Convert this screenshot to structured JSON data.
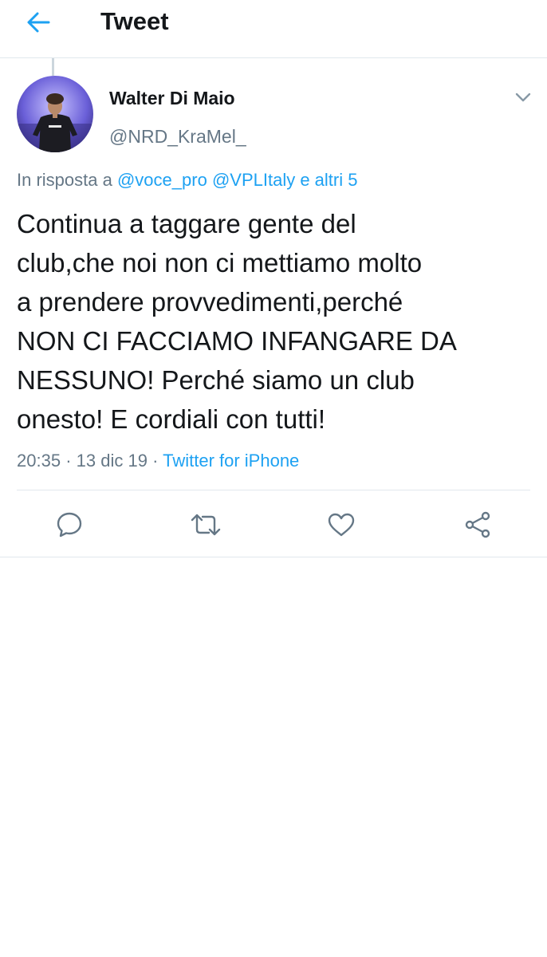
{
  "header": {
    "title": "Tweet",
    "back_icon": "arrow-left-icon"
  },
  "tweet": {
    "author": {
      "name": "Walter Di Maio",
      "handle": "@NRD_KraMel_",
      "avatar_icon": "avatar-image"
    },
    "reply": {
      "prefix": "In risposta a",
      "mention_1": "@voce_pro",
      "mention_2": "@VPLItaly",
      "others": "e altri 5"
    },
    "text": "Continua a taggare gente del\nclub,che noi non ci mettiamo molto\na prendere provvedimenti,perché\nNON CI FACCIAMO INFANGARE DA\nNESSUNO! Perché siamo un club\nonesto! E cordiali con tutti!",
    "time": "20:35",
    "separator": "·",
    "date": "13 dic 19",
    "source": "Twitter for iPhone"
  },
  "actions": [
    {
      "name": "reply",
      "icon": "reply-bubble-icon"
    },
    {
      "name": "retweet",
      "icon": "retweet-icon"
    },
    {
      "name": "like",
      "icon": "heart-icon"
    },
    {
      "name": "share",
      "icon": "share-icon"
    }
  ],
  "colors": {
    "accent": "#1da1f2",
    "text_primary": "#14171a",
    "text_secondary": "#657786",
    "border": "#e1e8ed"
  }
}
